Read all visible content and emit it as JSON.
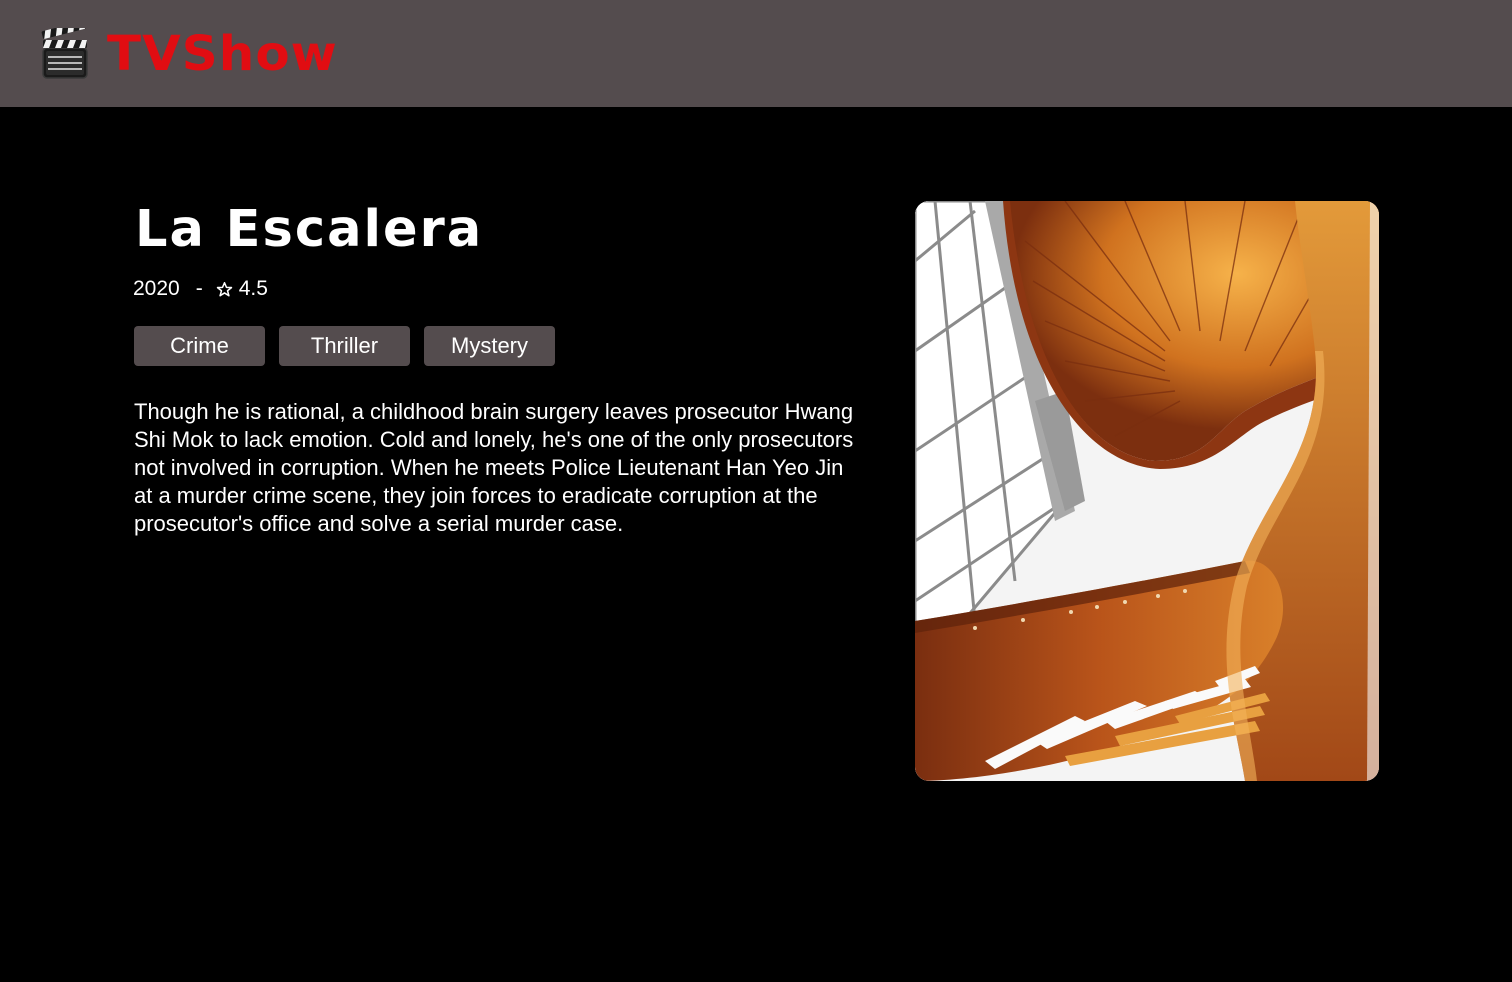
{
  "header": {
    "logo_icon": "clapperboard-icon",
    "app_name": "TVShow",
    "brand_color": "#e10d12",
    "background": "#544c4e"
  },
  "show": {
    "title": "La Escalera",
    "year": "2020",
    "separator": "-",
    "rating_icon": "star-icon",
    "rating": "4.5",
    "genres": [
      "Crime",
      "Thriller",
      "Mystery"
    ],
    "description": "Though he is rational, a childhood brain surgery leaves prosecutor Hwang Shi Mok to lack emotion. Cold and lonely, he's one of the only prosecutors not involved in corruption. When he meets Police Lieutenant Han Yeo Jin at a murder crime scene, they join forces to eradicate corruption at the prosecutor's office and solve a serial murder case."
  },
  "poster": {
    "subject": "spiral-staircase-image"
  }
}
